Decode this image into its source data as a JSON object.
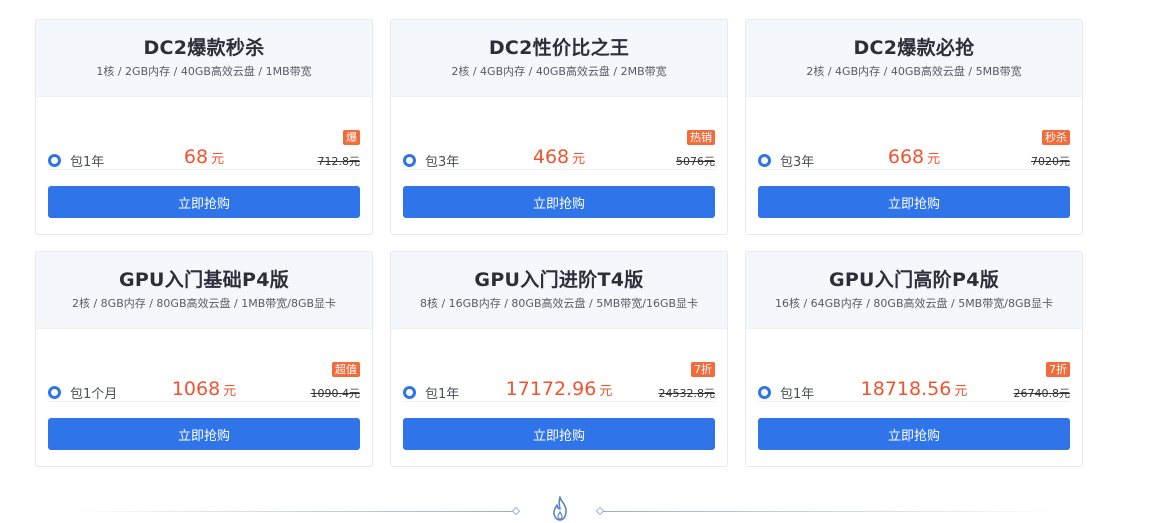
{
  "cards": [
    {
      "title": "DC2爆款秒杀",
      "spec": "1核 / 2GB内存 / 40GB高效云盘 / 1MB带宽",
      "period": "包1年",
      "price": "68",
      "unit": "元",
      "badge": "爆",
      "original": "712.8元",
      "button": "立即抢购"
    },
    {
      "title": "DC2性价比之王",
      "spec": "2核 / 4GB内存 / 40GB高效云盘 / 2MB带宽",
      "period": "包3年",
      "price": "468",
      "unit": "元",
      "badge": "热销",
      "original": "5076元",
      "button": "立即抢购"
    },
    {
      "title": "DC2爆款必抢",
      "spec": "2核 / 4GB内存 / 40GB高效云盘 / 5MB带宽",
      "period": "包3年",
      "price": "668",
      "unit": "元",
      "badge": "秒杀",
      "original": "7020元",
      "button": "立即抢购"
    },
    {
      "title": "GPU入门基础P4版",
      "spec": "2核 / 8GB内存 / 80GB高效云盘 / 1MB带宽/8GB显卡",
      "period": "包1个月",
      "price": "1068",
      "unit": "元",
      "badge": "超值",
      "original": "1090.4元",
      "button": "立即抢购"
    },
    {
      "title": "GPU入门进阶T4版",
      "spec": "8核 / 16GB内存 / 80GB高效云盘 / 5MB带宽/16GB显卡",
      "period": "包1年",
      "price": "17172.96",
      "unit": "元",
      "badge": "7折",
      "original": "24532.8元",
      "button": "立即抢购"
    },
    {
      "title": "GPU入门高阶P4版",
      "spec": "16核 / 64GB内存 / 80GB高效云盘 / 5MB带宽/8GB显卡",
      "period": "包1年",
      "price": "18718.56",
      "unit": "元",
      "badge": "7折",
      "original": "26740.8元",
      "button": "立即抢购"
    }
  ],
  "colors": {
    "accent": "#2f74e8",
    "price": "#f0542f",
    "badge": "#f26b3a"
  },
  "icons": {
    "section_divider": "flame-icon"
  }
}
